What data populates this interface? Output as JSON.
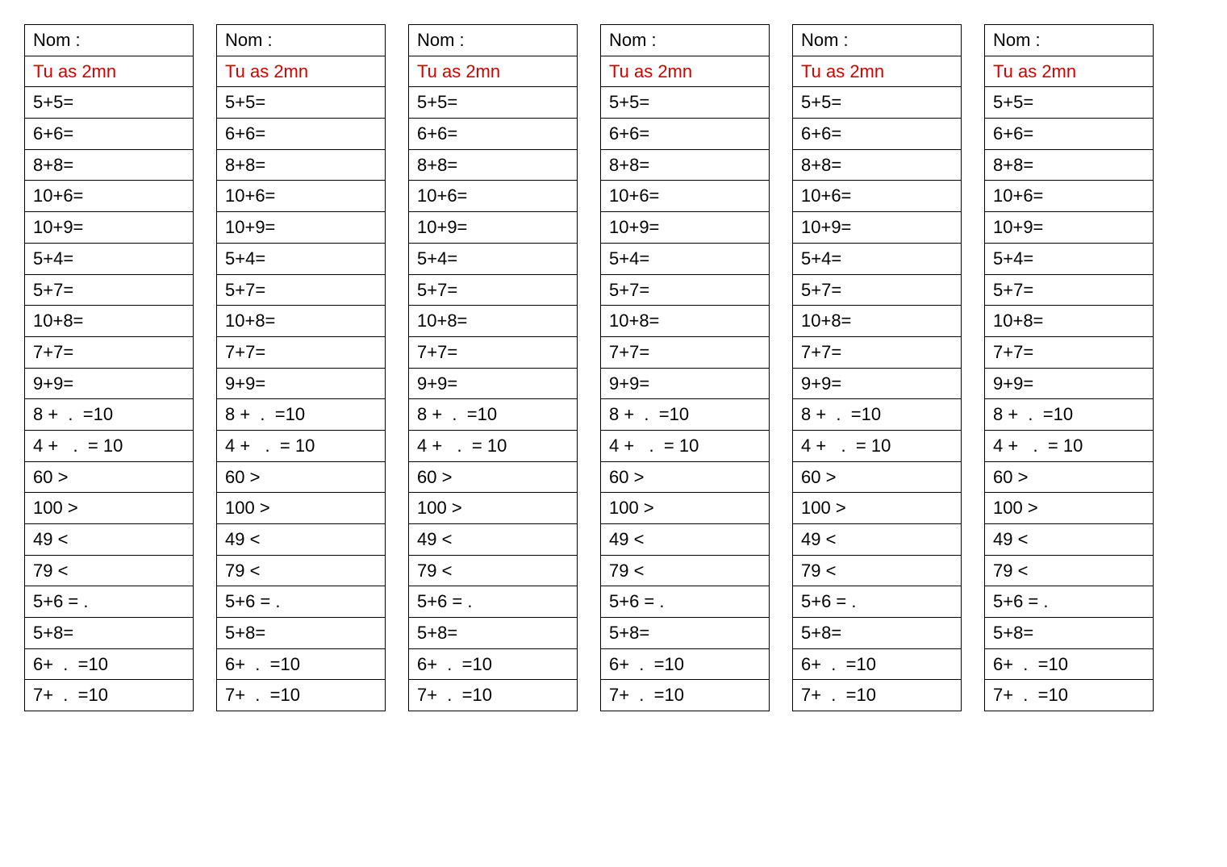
{
  "worksheet": {
    "name_label": "Nom :",
    "time_label": "Tu as 2mn",
    "problems": [
      "5+5=",
      "6+6=",
      "8+8=",
      "10+6=",
      "10+9=",
      "5+4=",
      "5+7=",
      "10+8=",
      "7+7=",
      "9+9=",
      "8 +  .  =10",
      "4 +   .  = 10",
      "60 >",
      "100 >",
      "49 <",
      "79 <",
      "5+6 = .",
      "5+8=",
      "6+  .  =10",
      "7+  .  =10"
    ],
    "copies": 6
  }
}
